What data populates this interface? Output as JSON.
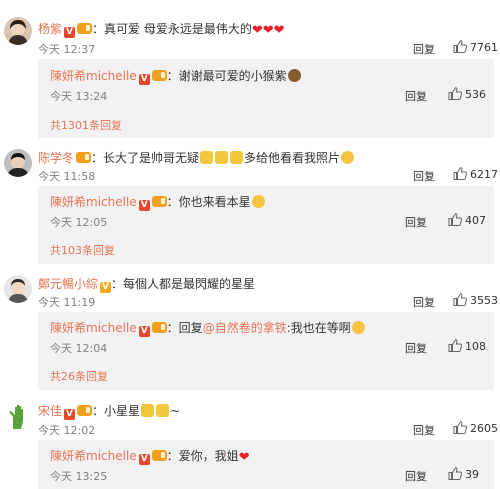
{
  "comments": [
    {
      "user": "杨紫",
      "text": "：真可爱 母爱永远是最伟大的",
      "time": "今天 12:37",
      "reply_label": "回复",
      "likes": "7761",
      "reply": {
        "user": "陳妍希michelle",
        "text": "：谢谢最可爱的小猴紫",
        "time": "今天 13:24",
        "reply_label": "回复",
        "likes": "536"
      },
      "more": "共1301条回复"
    },
    {
      "user": "陈学冬",
      "text": "：长大了是帅哥无疑",
      "text2": "多给他看看我照片",
      "time": "今天 11:58",
      "reply_label": "回复",
      "likes": "6217",
      "reply": {
        "user": "陳妍希michelle",
        "text": "：你也来看本星",
        "time": "今天 12:05",
        "reply_label": "回复",
        "likes": "407"
      },
      "more": "共103条回复"
    },
    {
      "user": "鄭元暢小綜",
      "text": "：每個人都是最閃耀的星星",
      "time": "今天 11:19",
      "reply_label": "回复",
      "likes": "3553",
      "reply": {
        "user": "陳妍希michelle",
        "text_prefix": "：回复",
        "mention": "@自然卷的拿铁",
        "text": ":我也在等啊",
        "time": "今天 12:04",
        "reply_label": "回复",
        "likes": "108"
      },
      "more": "共26条回复"
    },
    {
      "user": "宋佳",
      "text": "：小星星",
      "text2": "~",
      "time": "今天 12:02",
      "reply_label": "回复",
      "likes": "2605",
      "reply": {
        "user": "陳妍希michelle",
        "text": "：爱你，我姐",
        "time": "今天 13:25",
        "reply_label": "回复",
        "likes": "39"
      }
    }
  ],
  "colors": {
    "username": "#eb7350",
    "reply_bg": "#f2f2f5",
    "heart": "#e8202a",
    "vip": "#e8462b"
  },
  "icons": {
    "verified": "v-badge-icon",
    "level": "level-badge-icon",
    "like": "thumbs-up-icon"
  }
}
